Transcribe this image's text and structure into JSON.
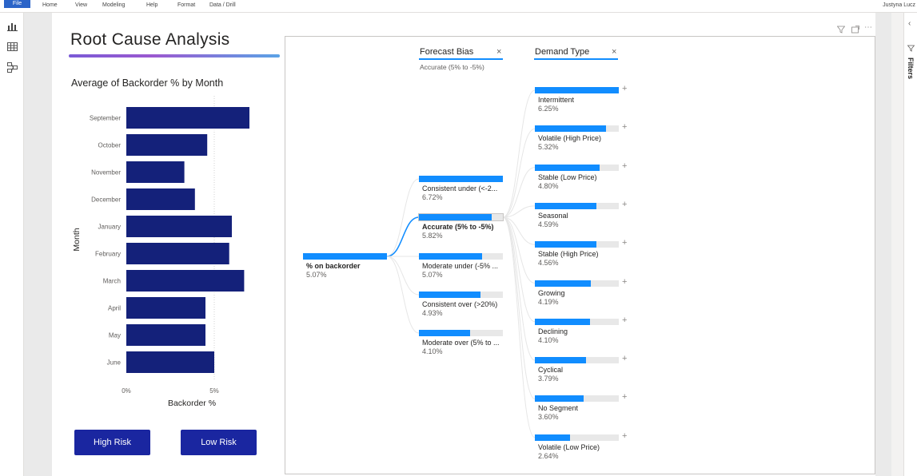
{
  "ribbon": {
    "file": "File",
    "menus": [
      "Home",
      "View",
      "Modeling",
      "Help",
      "Format",
      "Data / Drill"
    ],
    "user": "Justyna Lucz"
  },
  "rightpane": {
    "filters_label": "Filters"
  },
  "report": {
    "title": "Root Cause Analysis",
    "chart_title": "Average of Backorder % by Month",
    "buttons": {
      "high_risk": "High Risk",
      "low_risk": "Low Risk"
    }
  },
  "chart_data": {
    "type": "bar",
    "orientation": "horizontal",
    "categories": [
      "September",
      "October",
      "November",
      "December",
      "January",
      "February",
      "March",
      "April",
      "May",
      "June"
    ],
    "values": [
      7.0,
      4.6,
      3.3,
      3.9,
      6.0,
      5.85,
      6.7,
      4.5,
      4.5,
      5.0
    ],
    "xlabel": "Backorder %",
    "ylabel": "Month",
    "xticks": [
      "0%",
      "5%"
    ],
    "xlim": [
      0,
      7.5
    ],
    "bar_color": "#14217a",
    "grid": true
  },
  "decomp": {
    "root": {
      "label": "% on backorder",
      "value": "5.07%"
    },
    "levels": [
      {
        "name": "Forecast Bias",
        "selection": "Accurate (5% to -5%)"
      },
      {
        "name": "Demand Type",
        "selection": ""
      }
    ],
    "close_glyph": "×",
    "plus_glyph": "+",
    "bias_nodes": [
      {
        "label": "Consistent under (<-2...",
        "value": "6.72%",
        "fill": 1.0,
        "selected": false
      },
      {
        "label": "Accurate (5% to -5%)",
        "value": "5.82%",
        "fill": 0.87,
        "selected": true
      },
      {
        "label": "Moderate under (-5% ...",
        "value": "5.07%",
        "fill": 0.755,
        "selected": false
      },
      {
        "label": "Consistent over (>20%)",
        "value": "4.93%",
        "fill": 0.735,
        "selected": false
      },
      {
        "label": "Moderate over (5% to ...",
        "value": "4.10%",
        "fill": 0.61,
        "selected": false
      }
    ],
    "demand_nodes": [
      {
        "label": "Intermittent",
        "value": "6.25%",
        "fill": 1.0
      },
      {
        "label": "Volatile (High Price)",
        "value": "5.32%",
        "fill": 0.85
      },
      {
        "label": "Stable (Low Price)",
        "value": "4.80%",
        "fill": 0.77
      },
      {
        "label": "Seasonal",
        "value": "4.59%",
        "fill": 0.73
      },
      {
        "label": "Stable (High Price)",
        "value": "4.56%",
        "fill": 0.73
      },
      {
        "label": "Growing",
        "value": "4.19%",
        "fill": 0.67
      },
      {
        "label": "Declining",
        "value": "4.10%",
        "fill": 0.66
      },
      {
        "label": "Cyclical",
        "value": "3.79%",
        "fill": 0.61
      },
      {
        "label": "No Segment",
        "value": "3.60%",
        "fill": 0.58
      },
      {
        "label": "Volatile (Low Price)",
        "value": "2.64%",
        "fill": 0.42
      }
    ],
    "colors": {
      "accent": "#118dff",
      "track": "#e8e8e8"
    }
  }
}
